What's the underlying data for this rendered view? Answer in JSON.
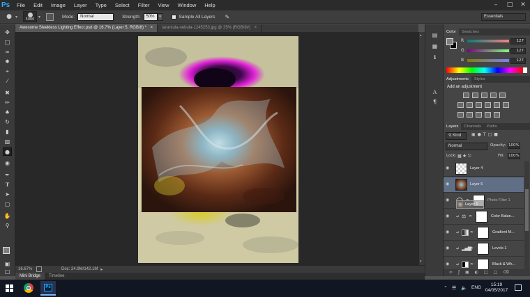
{
  "app": {
    "logo": "Ps"
  },
  "menu": [
    "File",
    "Edit",
    "Image",
    "Layer",
    "Type",
    "Select",
    "Filter",
    "View",
    "Window",
    "Help"
  ],
  "window_controls": {
    "minimize": "–",
    "maximize": "□",
    "close": "✕"
  },
  "options": {
    "brush_size": "5000",
    "mode_label": "Mode:",
    "mode_value": "Normal",
    "strength_label": "Strength:",
    "strength_value": "50%",
    "sample_label": "Sample All Layers",
    "workspace": "Essentials"
  },
  "tabs": [
    {
      "label": "Awesome Sleekless Lighting Effect.psd @ 16.7% (Layer 5, RGB/8) *",
      "active": true
    },
    {
      "label": "tarantula-nebula-1245253.jpg @ 25% (RGB/8#)",
      "active": false
    }
  ],
  "status": {
    "zoom": "16.67%",
    "doc": "Doc: 24.9M/142.1M"
  },
  "bottom_tabs": [
    "Mini Bridge",
    "Timeline"
  ],
  "color_panel": {
    "tabs": [
      "Color",
      "Swatches"
    ],
    "r_label": "R",
    "r": "127",
    "g_label": "G",
    "g": "127",
    "b_label": "B",
    "b": "127"
  },
  "adjustments_panel": {
    "tabs": [
      "Adjustments",
      "Styles"
    ],
    "title": "Add an adjustment"
  },
  "layers_panel": {
    "tabs": [
      "Layers",
      "Channels",
      "Paths"
    ],
    "kind_label": "Kind",
    "blend_mode": "Normal",
    "opacity_label": "Opacity:",
    "opacity_value": "100%",
    "lock_label": "Lock:",
    "fill_label": "Fill:",
    "fill_value": "100%",
    "layers": [
      {
        "name": "Layer 4"
      },
      {
        "name": "Layer 5"
      },
      {
        "name": "Photo Filter 1"
      },
      {
        "name": "Color Balan..."
      },
      {
        "name": "Gradient M..."
      },
      {
        "name": "Levels 1"
      },
      {
        "name": "Black & Wh..."
      }
    ],
    "drag_ghost": "Layer 5"
  },
  "taskbar": {
    "language": "ENG",
    "time": "15:19",
    "date": "04/05/2017"
  },
  "colors": {
    "accent": "#31a8ff",
    "selected_layer": "#606f86",
    "canvas_bg": "#282828"
  }
}
